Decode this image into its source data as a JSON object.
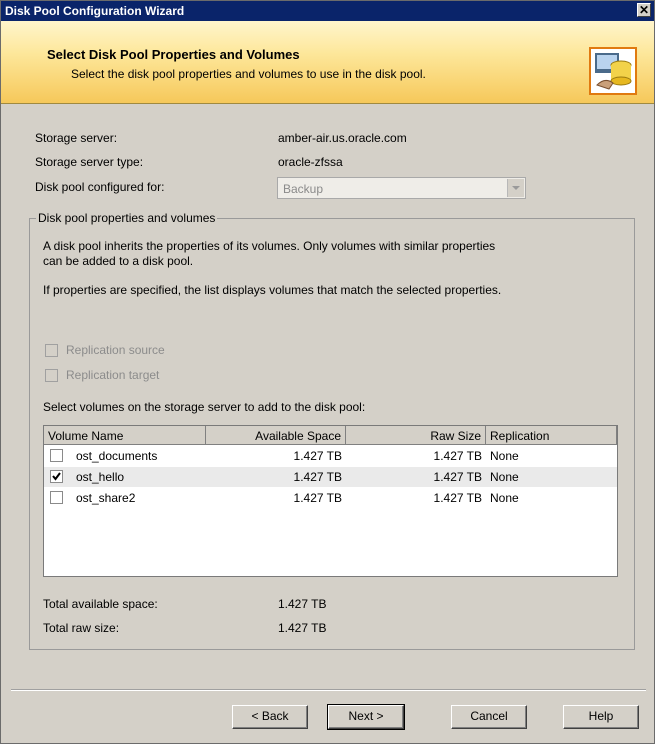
{
  "window": {
    "title": "Disk Pool Configuration Wizard",
    "close_glyph": "✕"
  },
  "header": {
    "title": "Select Disk Pool Properties and Volumes",
    "subtitle": "Select the disk pool properties and volumes to use in the disk pool.",
    "icon": "disk-pool-icon"
  },
  "info": {
    "storage_server_label": "Storage server:",
    "storage_server_value": "amber-air.us.oracle.com",
    "storage_server_type_label": "Storage server type:",
    "storage_server_type_value": "oracle-zfssa",
    "configured_for_label": "Disk pool configured for:",
    "configured_for_value": "Backup"
  },
  "group": {
    "legend": "Disk pool properties and volumes",
    "desc1": "A disk pool inherits the properties of its volumes. Only volumes with similar properties",
    "desc2": "can be added to a disk pool.",
    "desc3": "If properties are specified, the list displays volumes that match the selected properties.",
    "replication_source": "Replication source",
    "replication_target": "Replication target",
    "select_prompt": "Select volumes on the storage server to add to the disk pool:"
  },
  "table": {
    "columns": [
      "Volume Name",
      "Available Space",
      "Raw Size",
      "Replication"
    ],
    "rows": [
      {
        "name": "ost_documents",
        "available": "1.427 TB",
        "raw": "1.427 TB",
        "replication": "None",
        "checked": false
      },
      {
        "name": "ost_hello",
        "available": "1.427 TB",
        "raw": "1.427 TB",
        "replication": "None",
        "checked": true
      },
      {
        "name": "ost_share2",
        "available": "1.427 TB",
        "raw": "1.427 TB",
        "replication": "None",
        "checked": false
      }
    ]
  },
  "totals": {
    "available_label": "Total available space:",
    "available_value": "1.427 TB",
    "raw_label": "Total raw size:",
    "raw_value": "1.427 TB"
  },
  "buttons": {
    "back": "< Back",
    "next": "Next >",
    "cancel": "Cancel",
    "help": "Help"
  }
}
